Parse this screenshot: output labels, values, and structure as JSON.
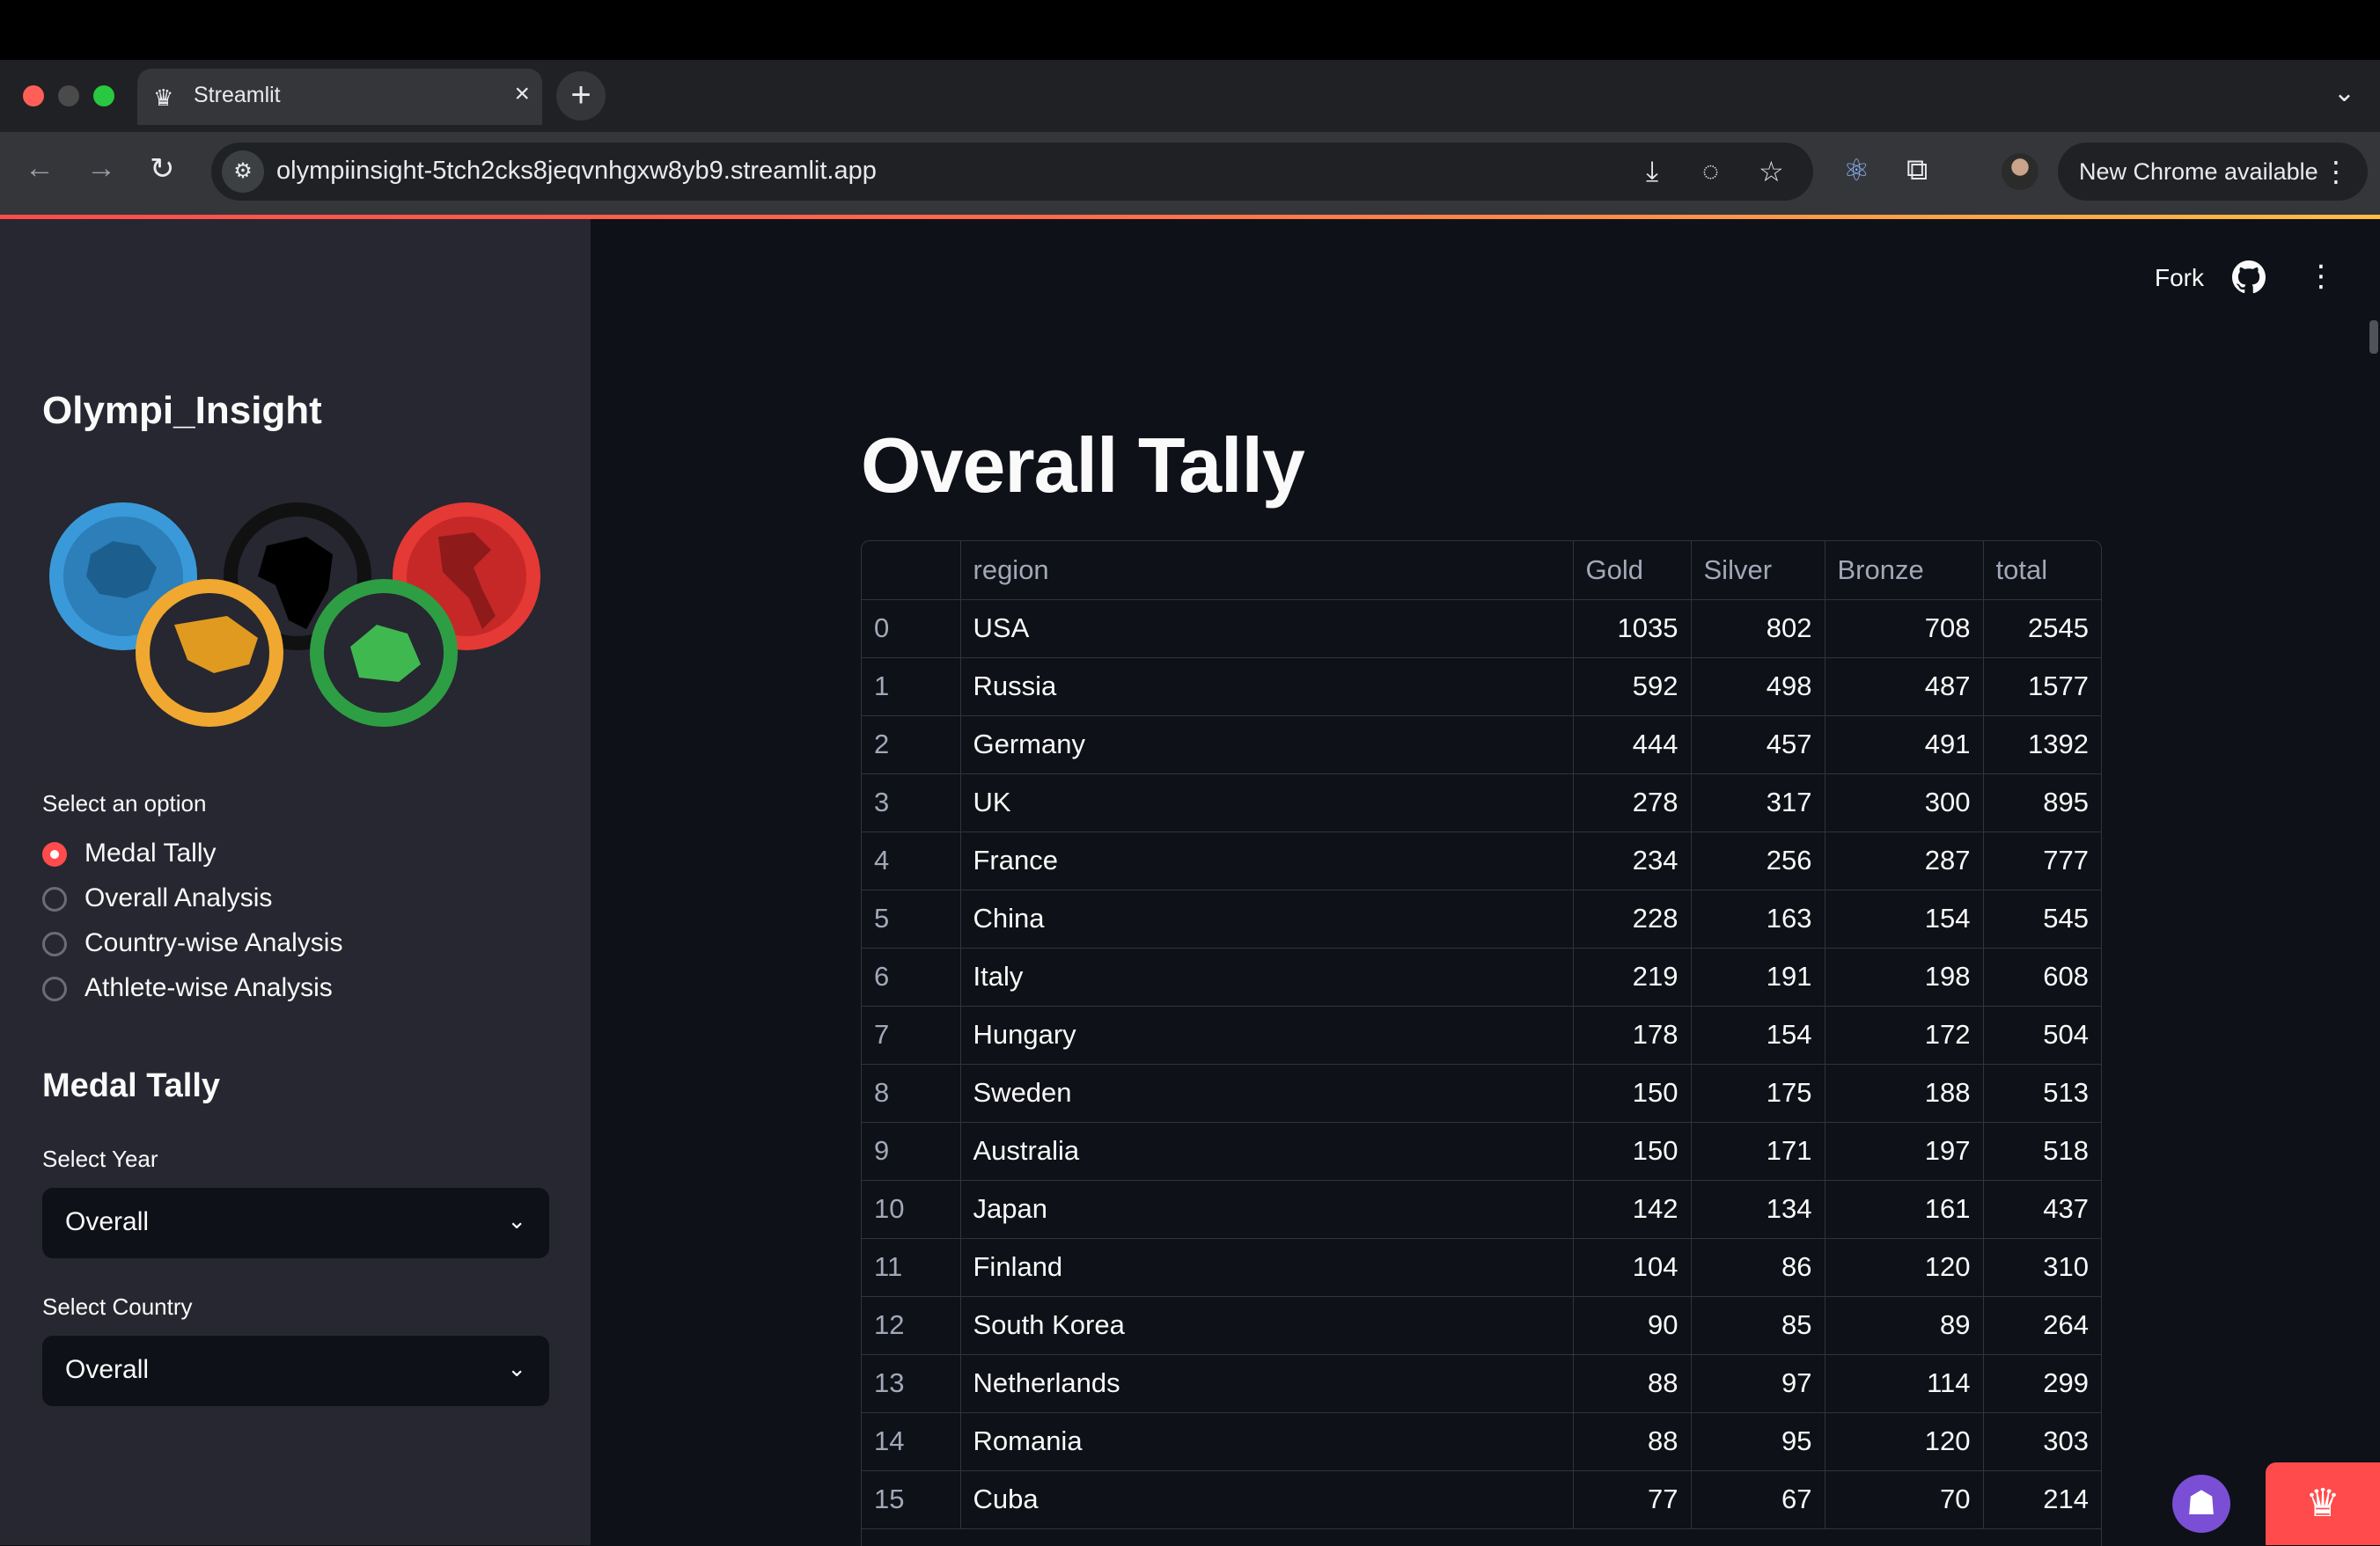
{
  "browser": {
    "tab_title": "Streamlit",
    "tab_favicon": "streamlit-crown-icon",
    "url": "olympiinsight-5tch2cks8jeqvnhgxw8yb9.streamlit.app",
    "update_label": "New Chrome available"
  },
  "header": {
    "fork_label": "Fork"
  },
  "sidebar": {
    "app_title": "Olympi_Insight",
    "option_label": "Select an option",
    "options": [
      {
        "label": "Medal Tally",
        "selected": true
      },
      {
        "label": "Overall Analysis",
        "selected": false
      },
      {
        "label": "Country-wise Analysis",
        "selected": false
      },
      {
        "label": "Athlete-wise Analysis",
        "selected": false
      }
    ],
    "section_title": "Medal Tally",
    "year_label": "Select Year",
    "year_value": "Overall",
    "country_label": "Select Country",
    "country_value": "Overall"
  },
  "main": {
    "title": "Overall Tally",
    "table": {
      "columns": [
        "",
        "region",
        "Gold",
        "Silver",
        "Bronze",
        "total"
      ],
      "rows": [
        [
          "0",
          "USA",
          "1035",
          "802",
          "708",
          "2545"
        ],
        [
          "1",
          "Russia",
          "592",
          "498",
          "487",
          "1577"
        ],
        [
          "2",
          "Germany",
          "444",
          "457",
          "491",
          "1392"
        ],
        [
          "3",
          "UK",
          "278",
          "317",
          "300",
          "895"
        ],
        [
          "4",
          "France",
          "234",
          "256",
          "287",
          "777"
        ],
        [
          "5",
          "China",
          "228",
          "163",
          "154",
          "545"
        ],
        [
          "6",
          "Italy",
          "219",
          "191",
          "198",
          "608"
        ],
        [
          "7",
          "Hungary",
          "178",
          "154",
          "172",
          "504"
        ],
        [
          "8",
          "Sweden",
          "150",
          "175",
          "188",
          "513"
        ],
        [
          "9",
          "Australia",
          "150",
          "171",
          "197",
          "518"
        ],
        [
          "10",
          "Japan",
          "142",
          "134",
          "161",
          "437"
        ],
        [
          "11",
          "Finland",
          "104",
          "86",
          "120",
          "310"
        ],
        [
          "12",
          "South Korea",
          "90",
          "85",
          "89",
          "264"
        ],
        [
          "13",
          "Netherlands",
          "88",
          "97",
          "114",
          "299"
        ],
        [
          "14",
          "Romania",
          "88",
          "95",
          "120",
          "303"
        ],
        [
          "15",
          "Cuba",
          "77",
          "67",
          "70",
          "214"
        ]
      ]
    }
  },
  "colors": {
    "accent": "#ff4b4b",
    "sidebar_bg": "#262730",
    "main_bg": "#0e1117"
  }
}
